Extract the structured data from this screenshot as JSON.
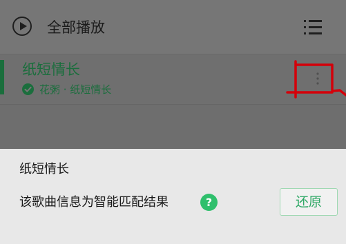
{
  "header": {
    "play_all_label": "全部播放"
  },
  "song": {
    "title": "纸短情长",
    "subtitle": "花粥 · 纸短情长"
  },
  "sheet": {
    "title": "纸短情长",
    "info": "该歌曲信息为智能匹配结果",
    "help_glyph": "?",
    "restore_label": "还原"
  },
  "colors": {
    "accent_green": "#2fbf6c",
    "dim_green": "#1b6e3d",
    "annotation_red": "#d4000a"
  }
}
